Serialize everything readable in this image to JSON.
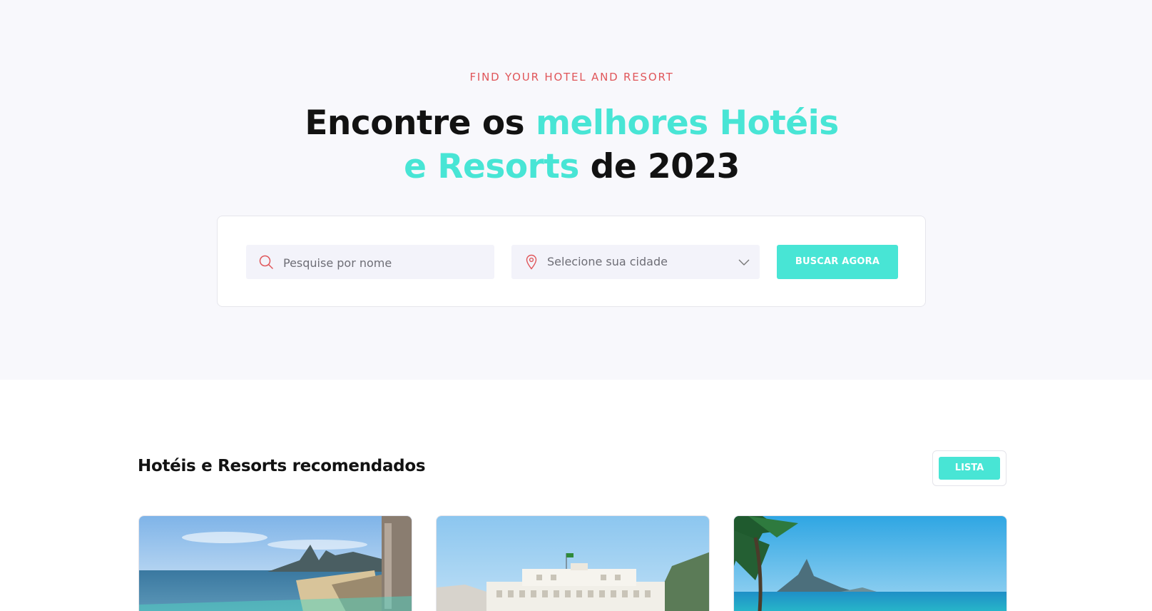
{
  "hero": {
    "eyebrow": "FIND YOUR HOTEL AND RESORT",
    "headline_part1": "Encontre os ",
    "headline_accent1": "melhores Hotéis",
    "headline_accent2": "e Resorts",
    "headline_part2": " de 2023"
  },
  "search": {
    "name_placeholder": "Pesquise por nome",
    "city_placeholder": "Selecione sua cidade",
    "button_label": "BUSCAR AGORA"
  },
  "recommended": {
    "title": "Hotéis e Resorts recomendados",
    "view_toggle_label": "LISTA"
  },
  "colors": {
    "accent": "#48e5d5",
    "eyebrow": "#e0565a",
    "hero_bg": "#f8f8fc"
  },
  "icons": {
    "search": "search-icon",
    "location": "location-pin-icon",
    "dropdown": "chevron-down-icon"
  }
}
